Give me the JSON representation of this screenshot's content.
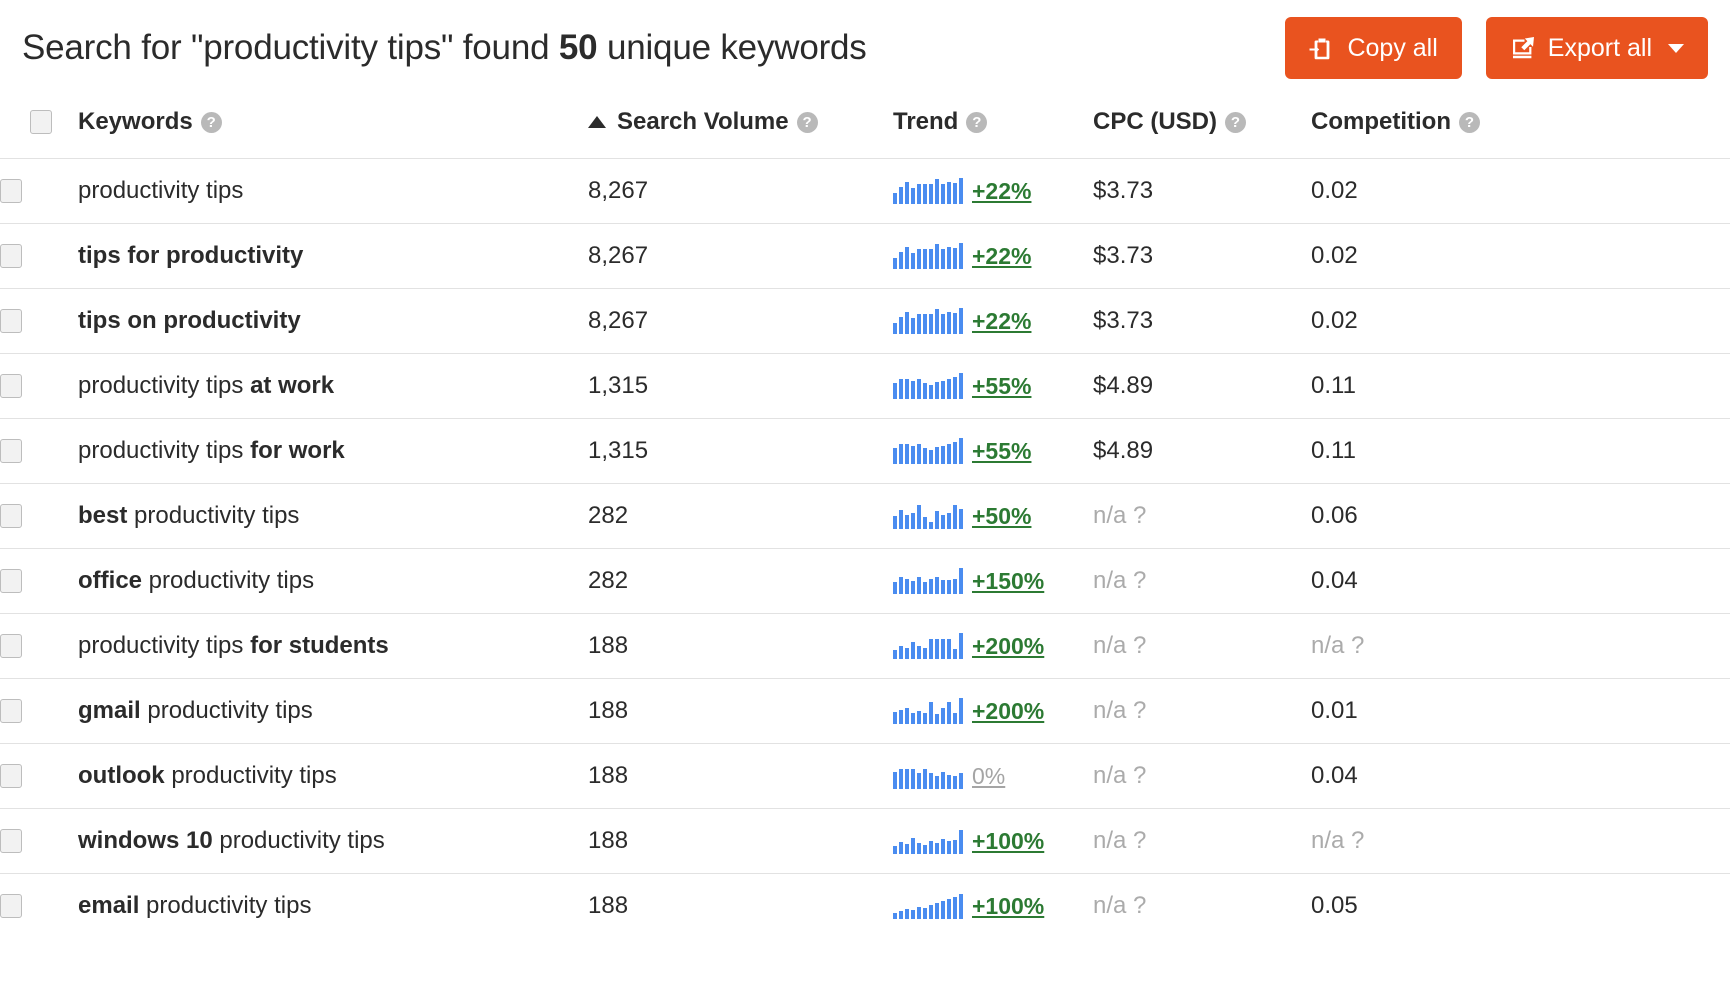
{
  "header": {
    "title_prefix": "Search for \"productivity tips\" found ",
    "title_count": "50",
    "title_suffix": " unique keywords",
    "copy_all_label": "Copy all",
    "export_all_label": "Export all"
  },
  "colors": {
    "accent": "#e9531f",
    "spark_bar": "#4a8cf0",
    "trend_positive": "#2c7a33",
    "trend_neutral": "#a5a5a5",
    "na_text": "#ababab"
  },
  "table": {
    "sort": {
      "column": "Search Volume",
      "direction": "asc"
    },
    "help_glyph": "?",
    "columns": [
      {
        "key": "select",
        "label": "",
        "help": false
      },
      {
        "key": "keywords",
        "label": "Keywords",
        "help": true
      },
      {
        "key": "volume",
        "label": "Search Volume",
        "help": true
      },
      {
        "key": "trend",
        "label": "Trend",
        "help": true
      },
      {
        "key": "cpc",
        "label": "CPC (USD)",
        "help": true
      },
      {
        "key": "comp",
        "label": "Competition",
        "help": true
      }
    ],
    "rows": [
      {
        "prefix": "",
        "prefix_bold": "",
        "base": "productivity tips",
        "suffix_bold": "",
        "volume": "8,267",
        "trend": "+22%",
        "trend_state": "up",
        "cpc": "$3.73",
        "cpc_na": false,
        "competition": "0.02",
        "comp_na": false,
        "spark": [
          11,
          17,
          22,
          16,
          20,
          20,
          20,
          25,
          20,
          22,
          21,
          26
        ]
      },
      {
        "prefix_bold": "tips for productivity",
        "base": "",
        "suffix_bold": "",
        "volume": "8,267",
        "trend": "+22%",
        "trend_state": "up",
        "cpc": "$3.73",
        "cpc_na": false,
        "competition": "0.02",
        "comp_na": false,
        "spark": [
          11,
          17,
          22,
          16,
          20,
          20,
          20,
          25,
          20,
          22,
          21,
          26
        ]
      },
      {
        "prefix_bold": "tips on productivity",
        "base": "",
        "suffix_bold": "",
        "volume": "8,267",
        "trend": "+22%",
        "trend_state": "up",
        "cpc": "$3.73",
        "cpc_na": false,
        "competition": "0.02",
        "comp_na": false,
        "spark": [
          11,
          17,
          22,
          16,
          20,
          20,
          20,
          25,
          20,
          22,
          21,
          26
        ]
      },
      {
        "prefix_bold": "",
        "base": "productivity tips ",
        "suffix_bold": "at work",
        "volume": "1,315",
        "trend": "+55%",
        "trend_state": "up",
        "cpc": "$4.89",
        "cpc_na": false,
        "competition": "0.11",
        "comp_na": false,
        "spark": [
          16,
          20,
          20,
          18,
          20,
          16,
          14,
          17,
          18,
          20,
          22,
          26
        ]
      },
      {
        "prefix_bold": "",
        "base": "productivity tips ",
        "suffix_bold": "for work",
        "volume": "1,315",
        "trend": "+55%",
        "trend_state": "up",
        "cpc": "$4.89",
        "cpc_na": false,
        "competition": "0.11",
        "comp_na": false,
        "spark": [
          16,
          20,
          20,
          18,
          20,
          16,
          14,
          17,
          18,
          20,
          22,
          26
        ]
      },
      {
        "prefix_bold": "best",
        "base": " productivity tips",
        "suffix_bold": "",
        "volume": "282",
        "trend": "+50%",
        "trend_state": "up",
        "cpc": "n/a ?",
        "cpc_na": true,
        "competition": "0.06",
        "comp_na": false,
        "spark": [
          13,
          19,
          14,
          16,
          24,
          12,
          7,
          18,
          14,
          16,
          24,
          20
        ]
      },
      {
        "prefix_bold": "office",
        "base": " productivity tips",
        "suffix_bold": "",
        "volume": "282",
        "trend": "+150%",
        "trend_state": "up",
        "cpc": "n/a ?",
        "cpc_na": true,
        "competition": "0.04",
        "comp_na": false,
        "spark": [
          12,
          17,
          15,
          13,
          17,
          12,
          15,
          17,
          14,
          14,
          15,
          26
        ]
      },
      {
        "prefix_bold": "",
        "base": "productivity tips ",
        "suffix_bold": "for students",
        "volume": "188",
        "trend": "+200%",
        "trend_state": "up",
        "cpc": "n/a ?",
        "cpc_na": true,
        "competition": "n/a ?",
        "comp_na": true,
        "spark": [
          9,
          13,
          11,
          17,
          13,
          11,
          20,
          20,
          20,
          20,
          10,
          26
        ]
      },
      {
        "prefix_bold": "gmail",
        "base": " productivity tips",
        "suffix_bold": "",
        "volume": "188",
        "trend": "+200%",
        "trend_state": "up",
        "cpc": "n/a ?",
        "cpc_na": true,
        "competition": "0.01",
        "comp_na": false,
        "spark": [
          12,
          14,
          16,
          11,
          13,
          11,
          22,
          10,
          16,
          22,
          11,
          26
        ]
      },
      {
        "prefix_bold": "outlook",
        "base": " productivity tips",
        "suffix_bold": "",
        "volume": "188",
        "trend": "0%",
        "trend_state": "flat",
        "cpc": "n/a ?",
        "cpc_na": true,
        "competition": "0.04",
        "comp_na": false,
        "spark": [
          17,
          20,
          20,
          20,
          16,
          20,
          16,
          13,
          17,
          14,
          13,
          16
        ]
      },
      {
        "prefix_bold": "windows 10",
        "base": " productivity tips",
        "suffix_bold": "",
        "volume": "188",
        "trend": "+100%",
        "trend_state": "up",
        "cpc": "n/a ?",
        "cpc_na": true,
        "competition": "n/a ?",
        "comp_na": true,
        "spark": [
          8,
          12,
          10,
          16,
          11,
          9,
          13,
          11,
          15,
          13,
          14,
          24
        ]
      },
      {
        "prefix_bold": "email",
        "base": " productivity tips",
        "suffix_bold": "",
        "volume": "188",
        "trend": "+100%",
        "trend_state": "up",
        "cpc": "n/a ?",
        "cpc_na": true,
        "competition": "0.05",
        "comp_na": false,
        "spark": [
          6,
          8,
          10,
          9,
          12,
          11,
          14,
          16,
          18,
          20,
          22,
          25
        ]
      }
    ]
  }
}
